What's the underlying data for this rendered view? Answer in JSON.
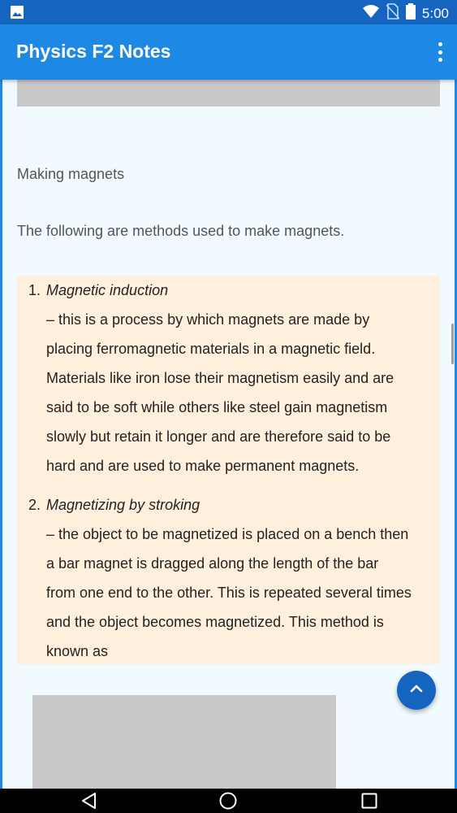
{
  "status_bar": {
    "time": "5:00",
    "icons": [
      "image-icon",
      "wifi-icon",
      "no-sim-icon",
      "battery-icon"
    ]
  },
  "app_bar": {
    "title": "Physics F2 Notes",
    "menu_icon": "overflow-menu-icon"
  },
  "content": {
    "heading": "Making magnets",
    "intro": "The following are methods used to make magnets.",
    "methods": [
      {
        "number": "1.",
        "name": "Magnetic induction",
        "lines": [
          "– this is a process by which magnets are made by",
          "placing ferromagnetic materials in a magnetic field.",
          "Materials like iron lose their magnetism easily and are",
          "said to be soft while others like steel gain magnetism",
          "slowly but retain it longer and are therefore said to be",
          "hard and are used to make permanent magnets."
        ]
      },
      {
        "number": "2.",
        "name": "Magnetizing by stroking",
        "lines": [
          "– the object to be magnetized is placed on a bench then",
          "a bar magnet is dragged along the length of the bar",
          "from one end to the other. This is repeated several times",
          "and the object becomes magnetized. This method is",
          "known as"
        ]
      }
    ]
  },
  "colors": {
    "status_bar": "#1565c0",
    "app_bar": "#1e88e5",
    "content_bg": "#f0faff",
    "list_bg": "#fff0dd",
    "fab": "#1565c0"
  },
  "nav_bar": {
    "icons": [
      "back-icon",
      "home-icon",
      "recents-icon"
    ]
  }
}
